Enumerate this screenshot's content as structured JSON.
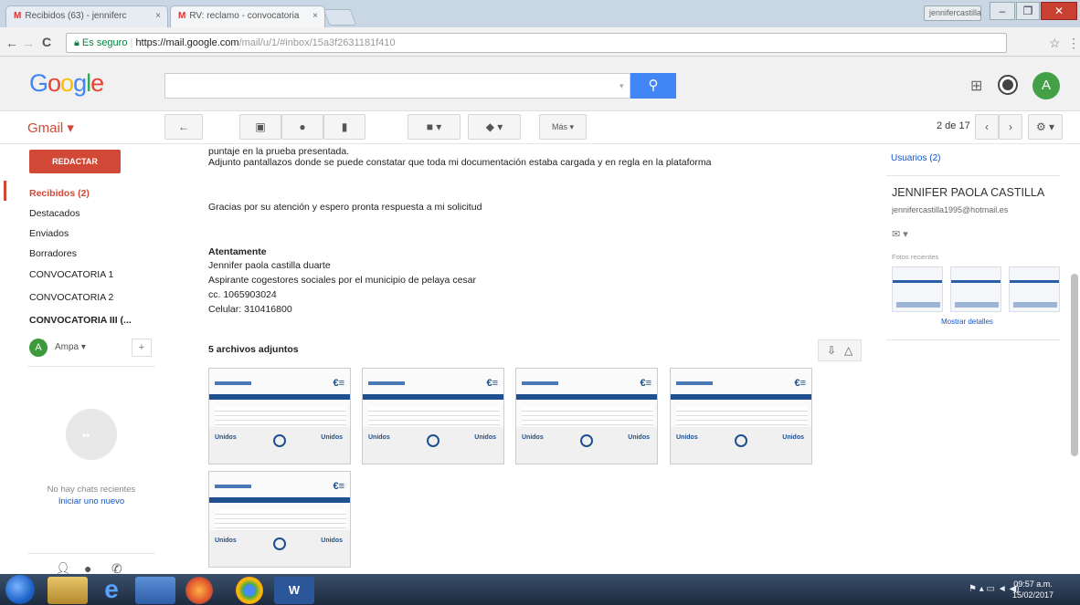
{
  "browser": {
    "tabs": [
      {
        "label": "Recibidos (63) - jenniferc"
      },
      {
        "label": "RV: reclamo - convocatoria"
      }
    ],
    "user_chip": "jennifercastilla",
    "nav": {
      "back": "←",
      "forward": "→",
      "reload": "C"
    },
    "url": {
      "secure_label": "Es seguro",
      "host": "https://mail.google.com",
      "path": "/mail/u/1/#inbox/15a3f2631181f410"
    }
  },
  "gmail_header": {
    "logo_letters": [
      "G",
      "o",
      "o",
      "g",
      "l",
      "e"
    ],
    "logo_colors": [
      "#4285f4",
      "#ea4335",
      "#fbbc05",
      "#4285f4",
      "#34a853",
      "#ea4335"
    ],
    "search_placeholder": "",
    "account_initial": "A"
  },
  "actionbar": {
    "gmail_label": "Gmail ▾",
    "buttons": [
      {
        "name": "back-button",
        "icon": "←"
      },
      {
        "name": "archive-button",
        "icon": "▣"
      },
      {
        "name": "report-spam-button",
        "icon": "●"
      },
      {
        "name": "delete-button",
        "icon": "▮"
      },
      {
        "name": "move-to-button",
        "icon": "■ ▾"
      },
      {
        "name": "labels-button",
        "icon": "◆ ▾"
      },
      {
        "name": "more-button",
        "icon": "Más ▾"
      }
    ],
    "pager": "2 de 17",
    "prev": "‹",
    "next": "›",
    "settings": "⚙ ▾"
  },
  "sidebar": {
    "compose": "REDACTAR",
    "items": [
      {
        "label": "Recibidos (2)"
      },
      {
        "label": "Destacados"
      },
      {
        "label": "Enviados"
      },
      {
        "label": "Borradores"
      },
      {
        "label": "CONVOCATORIA 1"
      },
      {
        "label": "CONVOCATORIA 2"
      },
      {
        "label": "CONVOCATORIA III (..."
      }
    ],
    "hangouts_user": "Ampa ▾",
    "hangouts_add": "+",
    "no_chats": "No hay chats recientes",
    "start_new": "Iniciar uno nuevo"
  },
  "message": {
    "lines": [
      "puntaje en la prueba presentada.",
      "Adjunto pantallazos donde se puede constatar que toda mi documentación estaba cargada y en regla en la plataforma",
      "Gracias por su atención y espero pronta respuesta a mi solicitud"
    ],
    "signoff": "Atentamente",
    "signature": [
      "Jennifer paola castilla duarte",
      "Aspirante cogestores sociales por el municipio de pelaya cesar",
      "cc. 1065903024",
      "Celular: 310416800"
    ],
    "attachments_header": "5 archivos adjuntos",
    "attachment_count": 5,
    "attachment_logo": "€≡",
    "attachment_foot_left": "Unidos",
    "attachment_foot_right": "Unidos"
  },
  "right_panel": {
    "people": "Usuarios (2)",
    "contact_name": "JENNIFER PAOLA CASTILLA",
    "contact_email": "jennifercastilla1995@hotmail.es",
    "mail_icon": "✉ ▾",
    "recent_label": "Fotos recientes",
    "show_details": "Mostrar detalles"
  },
  "taskbar": {
    "time": "09:57 a.m.",
    "date": "15/02/2017"
  }
}
